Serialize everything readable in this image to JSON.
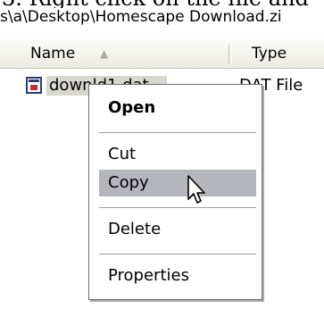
{
  "caption": "3. Right click on the file and",
  "window": {
    "path": "s\\a\\Desktop\\Homescape Download.zi"
  },
  "columns": {
    "name_label": "Name",
    "type_label": "Type"
  },
  "file": {
    "name": "downld1.dat",
    "type": "DAT File"
  },
  "context_menu": {
    "items": [
      {
        "label": "Open",
        "default": true
      },
      {
        "label": "Cut"
      },
      {
        "label": "Copy",
        "highlighted": true
      },
      {
        "label": "Delete"
      },
      {
        "label": "Properties"
      }
    ]
  },
  "colors": {
    "selection_bg": "#d7d7d0",
    "menu_highlight": "#b5b5bc",
    "header_bg": "#ecebe4"
  }
}
